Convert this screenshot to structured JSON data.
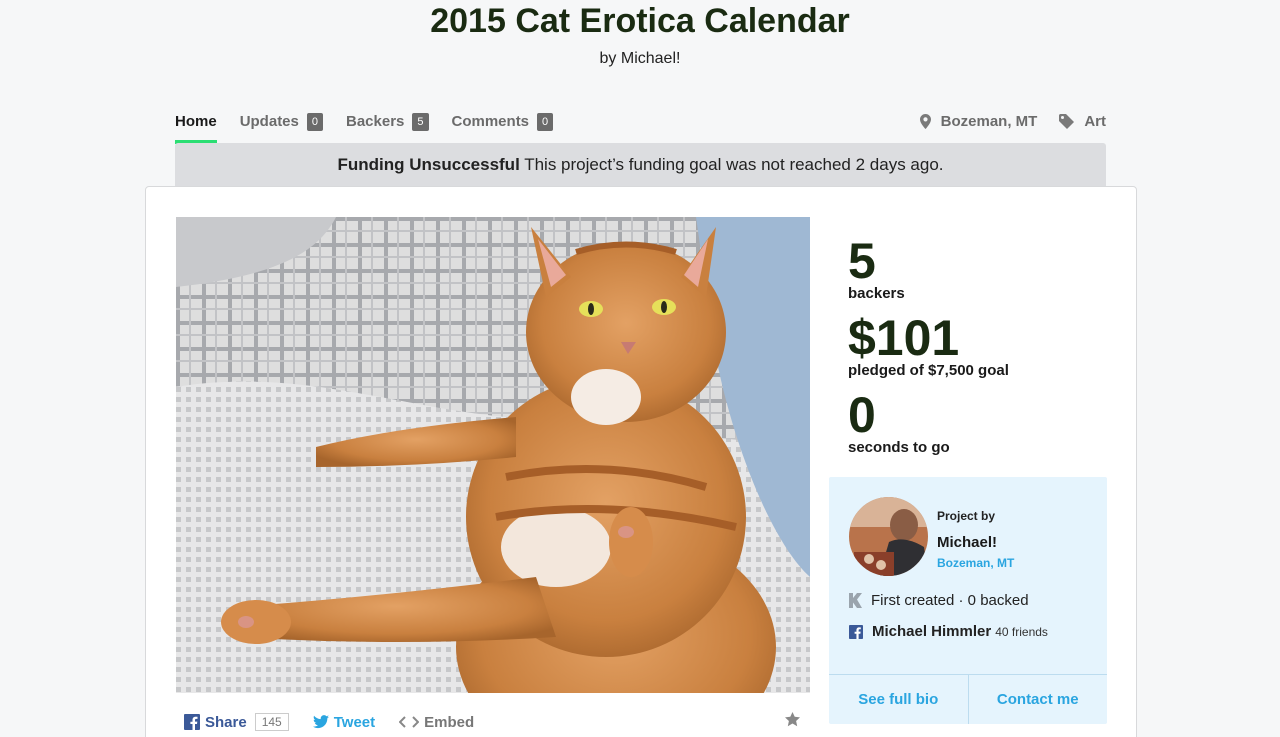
{
  "project": {
    "title": "2015 Cat Erotica Calendar",
    "byline": "by Michael!"
  },
  "nav": {
    "items": [
      {
        "label": "Home",
        "count": null,
        "active": true
      },
      {
        "label": "Updates",
        "count": "0"
      },
      {
        "label": "Backers",
        "count": "5"
      },
      {
        "label": "Comments",
        "count": "0"
      }
    ],
    "location": "Bozeman, MT",
    "category": "Art",
    "location_icon": "map-pin-icon",
    "category_icon": "tag-icon",
    "accent_color": "#2bde73"
  },
  "banner": {
    "status": "Funding Unsuccessful",
    "message": "This project’s funding goal was not reached 2 days ago."
  },
  "stats": {
    "backers_count": "5",
    "backers_label": "backers",
    "pledged_amount": "$101",
    "pledged_label": "pledged of $7,500 goal",
    "time_count": "0",
    "time_label": "seconds to go"
  },
  "creator": {
    "project_by_label": "Project by",
    "name": "Michael!",
    "location": "Bozeman, MT",
    "history": "First created · 0 backed",
    "facebook_name": "Michael Himmler",
    "facebook_friends": "40 friends",
    "see_bio": "See full bio",
    "contact": "Contact me",
    "link_color": "#2aa5e0"
  },
  "share": {
    "facebook_label": "Share",
    "facebook_count": "145",
    "tweet_label": "Tweet",
    "embed_label": "Embed",
    "facebook_color": "#3b5998",
    "twitter_color": "#2aa5e0"
  }
}
